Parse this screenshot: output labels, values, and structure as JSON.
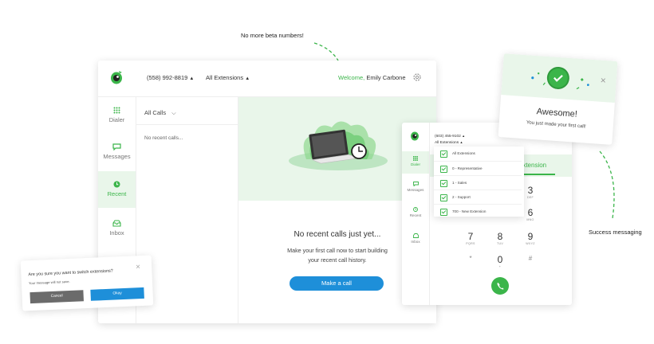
{
  "annotations": {
    "beta": "No more beta numbers!",
    "success": "Success messaging"
  },
  "main": {
    "phone": "(558) 992-8819",
    "extensions": "All Extensions",
    "welcome": "Welcome,",
    "user": "Emily Carbone",
    "nav": [
      {
        "label": "Dialer",
        "icon": "dialpad-icon"
      },
      {
        "label": "Messages",
        "icon": "message-icon"
      },
      {
        "label": "Recent",
        "icon": "clock-icon"
      },
      {
        "label": "Inbox",
        "icon": "inbox-icon"
      }
    ],
    "filter": "All Calls",
    "list_empty": "No recent calls...",
    "empty_title": "No recent calls just yet...",
    "empty_line1": "Make your first call now to start building",
    "empty_line2": "your recent call history.",
    "cta": "Make a call"
  },
  "confirm": {
    "title": "Are you sure you want to switch extensions?",
    "message": "Your message will not save.",
    "cancel": "Cancel",
    "ok": "Okay"
  },
  "mini": {
    "phone": "(603) 455-9102",
    "extensions": "All Extensions",
    "nav": [
      {
        "label": "Dialer",
        "icon": "dialpad-icon"
      },
      {
        "label": "Messages",
        "icon": "message-icon"
      },
      {
        "label": "Recent",
        "icon": "clock-icon"
      },
      {
        "label": "Inbox",
        "icon": "inbox-icon"
      }
    ],
    "dropdown": [
      "All Extensions",
      "0 - Representative",
      "1 - Sales",
      "2 - Support",
      "700 - New Extension"
    ],
    "tab": "Extension",
    "keys": [
      {
        "n": "3",
        "l": "DEF"
      },
      {
        "n": "6",
        "l": "MNO"
      },
      {
        "n": "",
        "l": "GHI"
      },
      {
        "n": "",
        "l": "JKL"
      },
      {
        "n": "7",
        "l": "PQRS"
      },
      {
        "n": "8",
        "l": "TUV"
      },
      {
        "n": "9",
        "l": "WXYZ"
      },
      {
        "n": "*",
        "l": ""
      },
      {
        "n": "0",
        "l": "+"
      },
      {
        "n": "#",
        "l": ""
      }
    ]
  },
  "toast": {
    "title": "Awesome!",
    "message": "You just made your first call!"
  },
  "colors": {
    "brand": "#3bb54a",
    "primary": "#1e8fd9",
    "cancel": "#6b6b6b"
  }
}
